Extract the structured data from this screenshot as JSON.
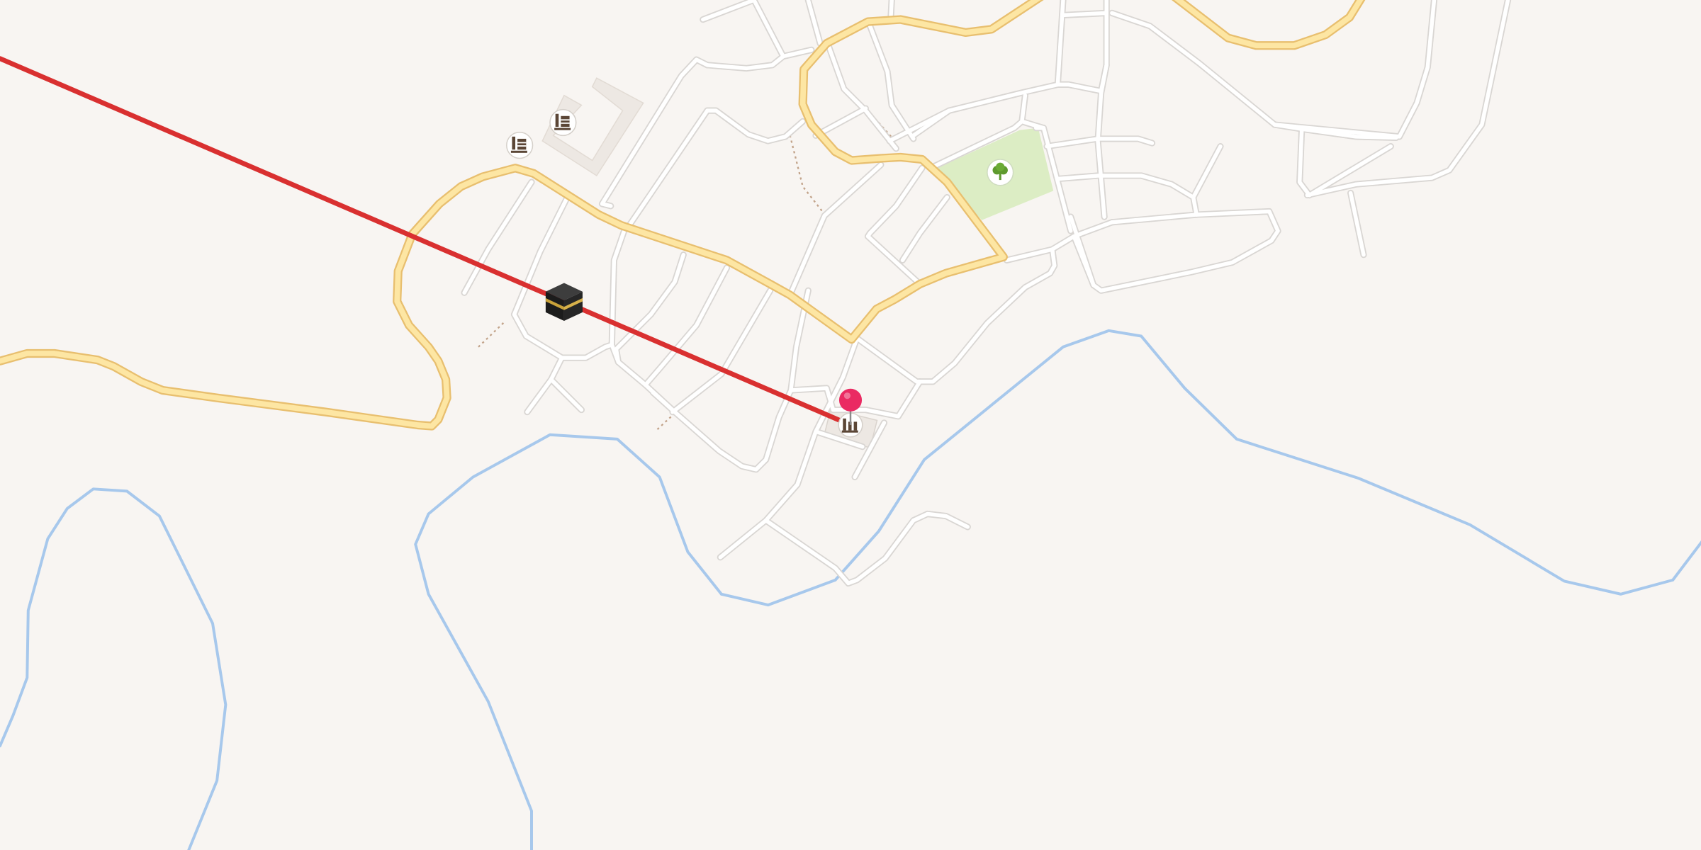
{
  "map": {
    "background_color": "#f8f5f2",
    "colors": {
      "street_fill": "#ffffff",
      "street_casing": "#d9d6d3",
      "main_road_fill": "#fde6a3",
      "main_road_casing": "#e8bf6f",
      "river": "#a7c8ec",
      "route_line": "#d93030",
      "park": "#dcedc4",
      "footpath": "#c2a38a",
      "building": "#ede8e3",
      "pin": "#ea2a62"
    },
    "markers": [
      {
        "name": "kaaba-poi",
        "icon": "kaaba-icon",
        "clickable": true
      },
      {
        "name": "mosque-poi-1",
        "icon": "mosque-minaret-icon",
        "clickable": true
      },
      {
        "name": "mosque-poi-2",
        "icon": "mosque-minaret-icon",
        "clickable": true
      },
      {
        "name": "mosque-poi-destination",
        "icon": "mosque-minaret-icon",
        "clickable": true
      },
      {
        "name": "park-poi",
        "icon": "tree-icon",
        "clickable": true
      },
      {
        "name": "location-pin",
        "icon": "map-pin-icon",
        "clickable": true
      }
    ],
    "route": {
      "name": "qibla-direction-line",
      "color": "#d93030"
    }
  }
}
